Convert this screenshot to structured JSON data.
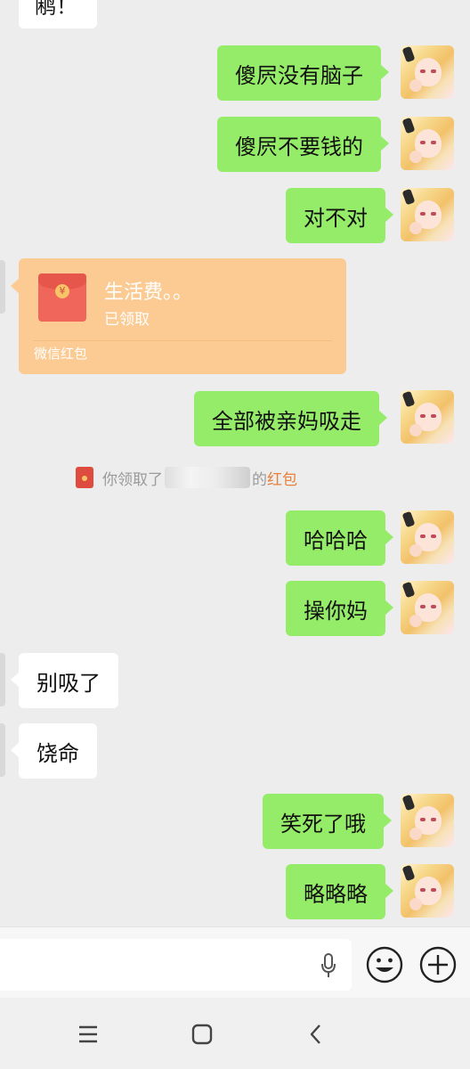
{
  "chat": {
    "top_partial_message": "鹇！",
    "messages": [
      {
        "id": "m1",
        "side": "out",
        "text": "傻屄没有脑子"
      },
      {
        "id": "m2",
        "side": "out",
        "text": "傻屄不要钱的"
      },
      {
        "id": "m3",
        "side": "out",
        "text": "对不对"
      },
      {
        "id": "m4",
        "side": "out",
        "text": "全部被亲妈吸走"
      },
      {
        "id": "m5",
        "side": "out",
        "text": "哈哈哈"
      },
      {
        "id": "m6",
        "side": "out",
        "text": "操你妈"
      },
      {
        "id": "m7",
        "side": "in",
        "text": "别吸了"
      },
      {
        "id": "m8",
        "side": "in",
        "text": "饶命"
      },
      {
        "id": "m9",
        "side": "out",
        "text": "笑死了哦"
      },
      {
        "id": "m10",
        "side": "out",
        "text": "略略略"
      }
    ],
    "red_packet": {
      "title": "生活费。。",
      "status": "已领取",
      "footer": "微信红包",
      "coin_symbol": "¥"
    },
    "system_message": {
      "prefix": "你领取了",
      "suffix": "的",
      "link": "红包"
    }
  },
  "input_bar": {
    "placeholder": "",
    "icons": [
      "microphone-icon",
      "emoji-icon",
      "plus-icon"
    ]
  },
  "nav_bar": {
    "icons": [
      "menu-icon",
      "home-icon",
      "back-icon"
    ]
  },
  "colors": {
    "background": "#ededed",
    "outgoing_bubble": "#95ec69",
    "incoming_bubble": "#ffffff",
    "red_packet": "#fbcb93",
    "link": "#e6803a"
  }
}
